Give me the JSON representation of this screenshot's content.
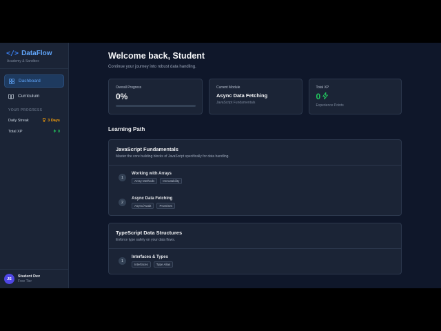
{
  "brand": {
    "name": "DataFlow",
    "subtitle": "Academy & Sandbox"
  },
  "nav": [
    {
      "label": "Dashboard",
      "icon": "grid-icon"
    },
    {
      "label": "Curriculum",
      "icon": "book-icon"
    }
  ],
  "progress_section": {
    "title": "YOUR PROGRESS",
    "streak_label": "Daily Streak",
    "streak_value": "3 Days",
    "xp_label": "Total XP",
    "xp_value": "0"
  },
  "user": {
    "initials": "JS",
    "name": "Student Dev",
    "plan": "Free Tier"
  },
  "header": {
    "welcome": "Welcome back, Student",
    "subtitle": "Continue your journey into robust data handling."
  },
  "cards": {
    "progress": {
      "label": "Overall Progress",
      "value": "0%",
      "fraction": 0
    },
    "module": {
      "label": "Current Module",
      "title": "Async Data Fetching",
      "subtitle": "JavaScript Fundamentals"
    },
    "xp": {
      "label": "Total XP",
      "value": "0",
      "subtitle": "Experience Points"
    }
  },
  "learning_path": {
    "title": "Learning Path",
    "modules": [
      {
        "title": "JavaScript Fundamentals",
        "description": "Master the core building blocks of JavaScript specifically for data handling.",
        "lessons": [
          {
            "num": "1",
            "title": "Working with Arrays",
            "tags": [
              "Array Methods",
              "Immutability"
            ]
          },
          {
            "num": "2",
            "title": "Async Data Fetching",
            "tags": [
              "Async/Await",
              "Promises"
            ]
          }
        ]
      },
      {
        "title": "TypeScript Data Structures",
        "description": "Enforce type safety on your data flows.",
        "lessons": [
          {
            "num": "1",
            "title": "Interfaces & Types",
            "tags": [
              "Interfaces",
              "Type Alias"
            ]
          }
        ]
      }
    ]
  },
  "colors": {
    "accent": "#3b82f6",
    "streak": "#f59e0b",
    "xp": "#22c55e",
    "avatar": "#4f46e5"
  }
}
